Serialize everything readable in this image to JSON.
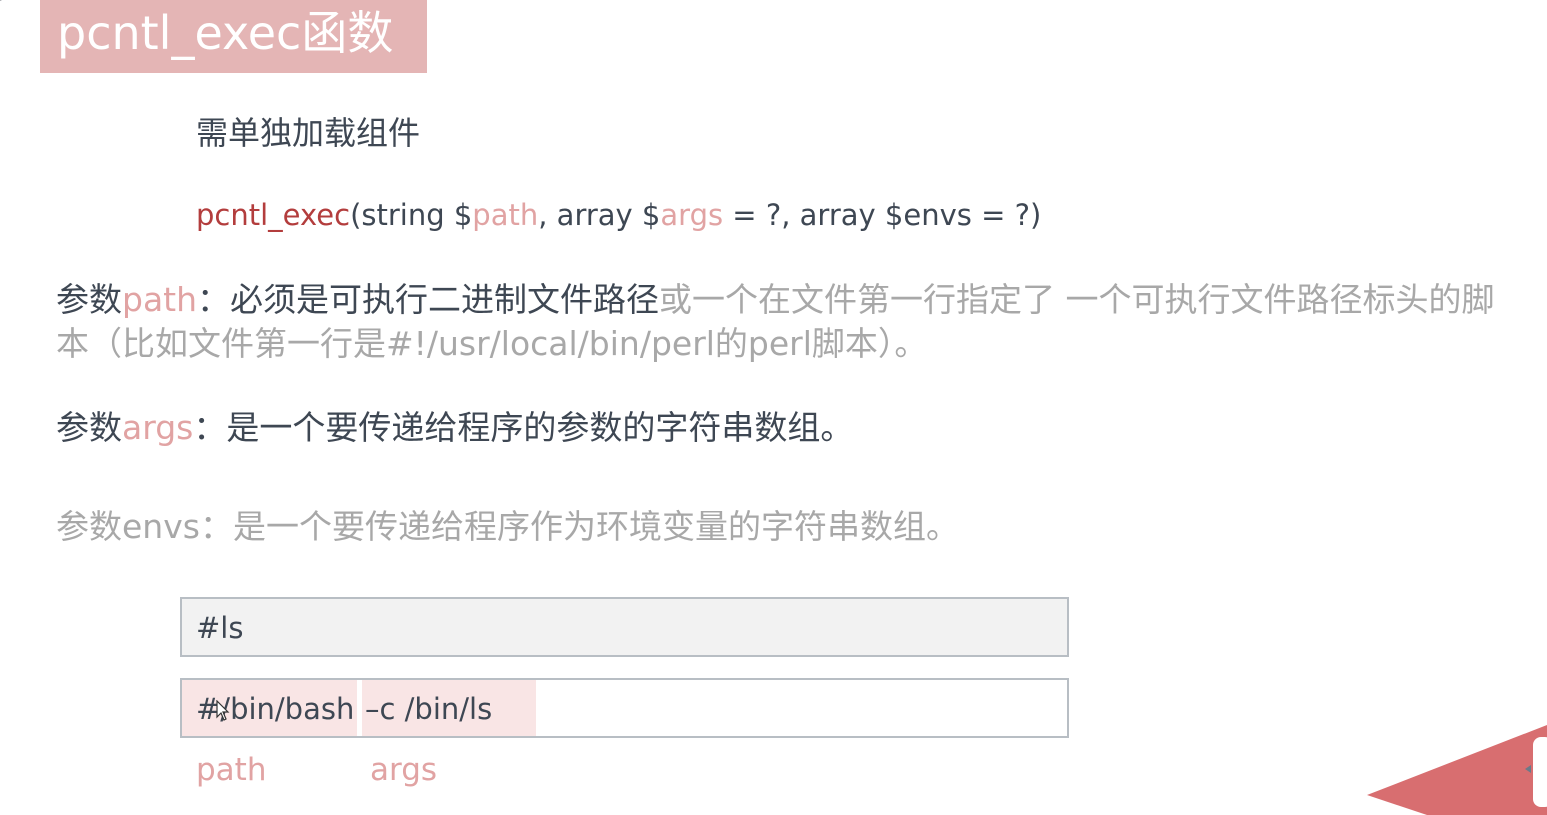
{
  "title": "pcntl_exec函数",
  "subtitle": "需单独加载组件",
  "signature": {
    "func": "pcntl_exec",
    "p1": "(string $",
    "v1": "path",
    "p2": ", array $",
    "v2": "args",
    "p3": " = ?, array $envs = ?)"
  },
  "params": {
    "path": {
      "prefix": "参数",
      "name": "path",
      "desc_strong": "：必须是可执行二进制文件路径",
      "desc_faded": "或一个在文件第一行指定了 一个可执行文件路径标头的脚本（比如文件第一行是#!/usr/local/bin/perl的perl脚本）。"
    },
    "args": {
      "prefix": "参数",
      "name": "args",
      "desc": "：是一个要传递给程序的参数的字符串数组。"
    },
    "envs": {
      "text": "参数envs：是一个要传递给程序作为环境变量的字符串数组。"
    }
  },
  "code": {
    "line1": "#ls",
    "path_part": "#/bin/bash",
    "args_part": "–c /bin/ls"
  },
  "labels": {
    "path": "path",
    "args": "args"
  },
  "icons": {
    "cursor": "mouse-cursor-icon",
    "decoration": "corner-triangle-decoration"
  },
  "colors": {
    "banner": "#e4b5b5",
    "accent_red": "#b33d3d",
    "accent_pink": "#e1a3a3",
    "highlight": "#f9e5e5",
    "triangle": "#d86e70"
  }
}
